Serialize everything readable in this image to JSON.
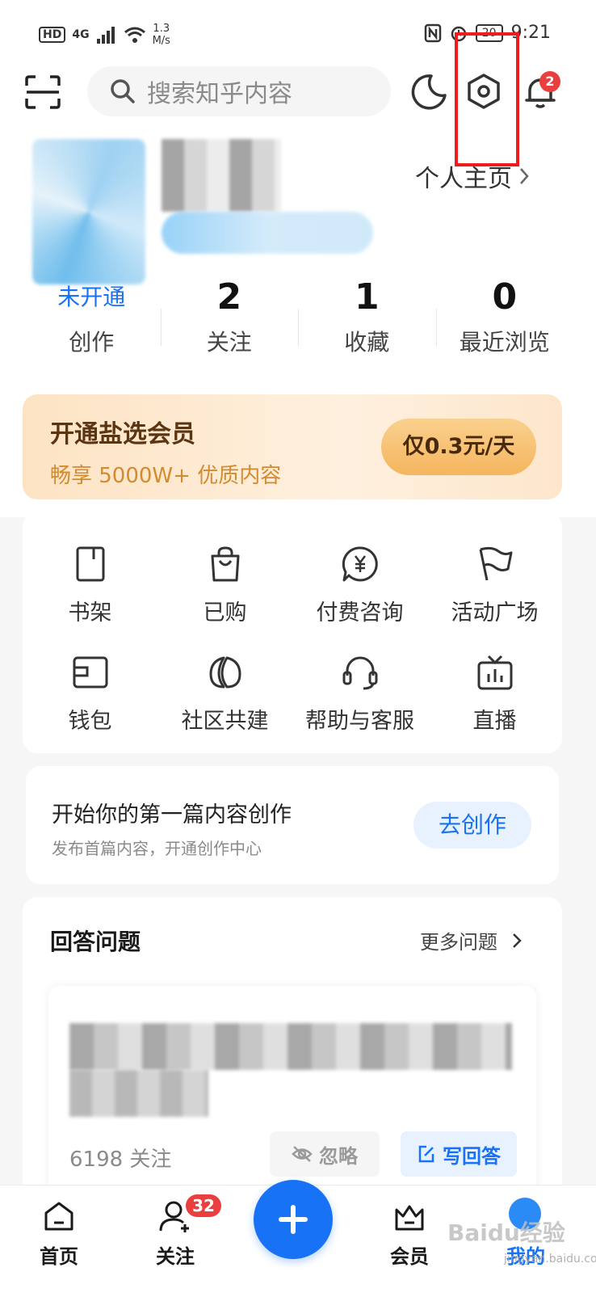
{
  "status_bar": {
    "hd": "HD",
    "signal": "4G",
    "speed": "1.3\nM/s",
    "battery": "20",
    "time": "9:21"
  },
  "header": {
    "search_placeholder": "搜索知乎内容",
    "notification_count": "2"
  },
  "profile": {
    "link_label": "个人主页"
  },
  "stats": [
    {
      "value": "未开通",
      "label": "创作"
    },
    {
      "value": "2",
      "label": "关注"
    },
    {
      "value": "1",
      "label": "收藏"
    },
    {
      "value": "0",
      "label": "最近浏览"
    }
  ],
  "vip": {
    "title": "开通盐选会员",
    "subtitle": "畅享 5000W+ 优质内容",
    "button": "仅0.3元/天"
  },
  "services": [
    {
      "label": "书架",
      "icon": "bookshelf-icon"
    },
    {
      "label": "已购",
      "icon": "shopping-bag-icon"
    },
    {
      "label": "付费咨询",
      "icon": "paid-consult-icon"
    },
    {
      "label": "活动广场",
      "icon": "flag-icon"
    },
    {
      "label": "钱包",
      "icon": "wallet-icon"
    },
    {
      "label": "社区共建",
      "icon": "community-icon"
    },
    {
      "label": "帮助与客服",
      "icon": "headset-icon"
    },
    {
      "label": "直播",
      "icon": "live-tv-icon"
    }
  ],
  "create": {
    "title": "开始你的第一篇内容创作",
    "subtitle": "发布首篇内容，开通创作中心",
    "button": "去创作"
  },
  "answer": {
    "title": "回答问题",
    "more": "更多问题",
    "question": {
      "followers": "6198 关注",
      "ignore": "忽略",
      "write": "写回答"
    }
  },
  "bottom_nav": {
    "items": [
      {
        "label": "首页"
      },
      {
        "label": "关注"
      },
      {
        "label": "会员"
      },
      {
        "label": "我的"
      }
    ],
    "follow_badge": "32"
  },
  "watermark": {
    "brand": "Baidu经验",
    "url": "jingyan.baidu.com"
  },
  "colors": {
    "brand_blue": "#1772f6",
    "highlight_red": "#ee1c1c",
    "badge_red": "#ea3f3f"
  }
}
